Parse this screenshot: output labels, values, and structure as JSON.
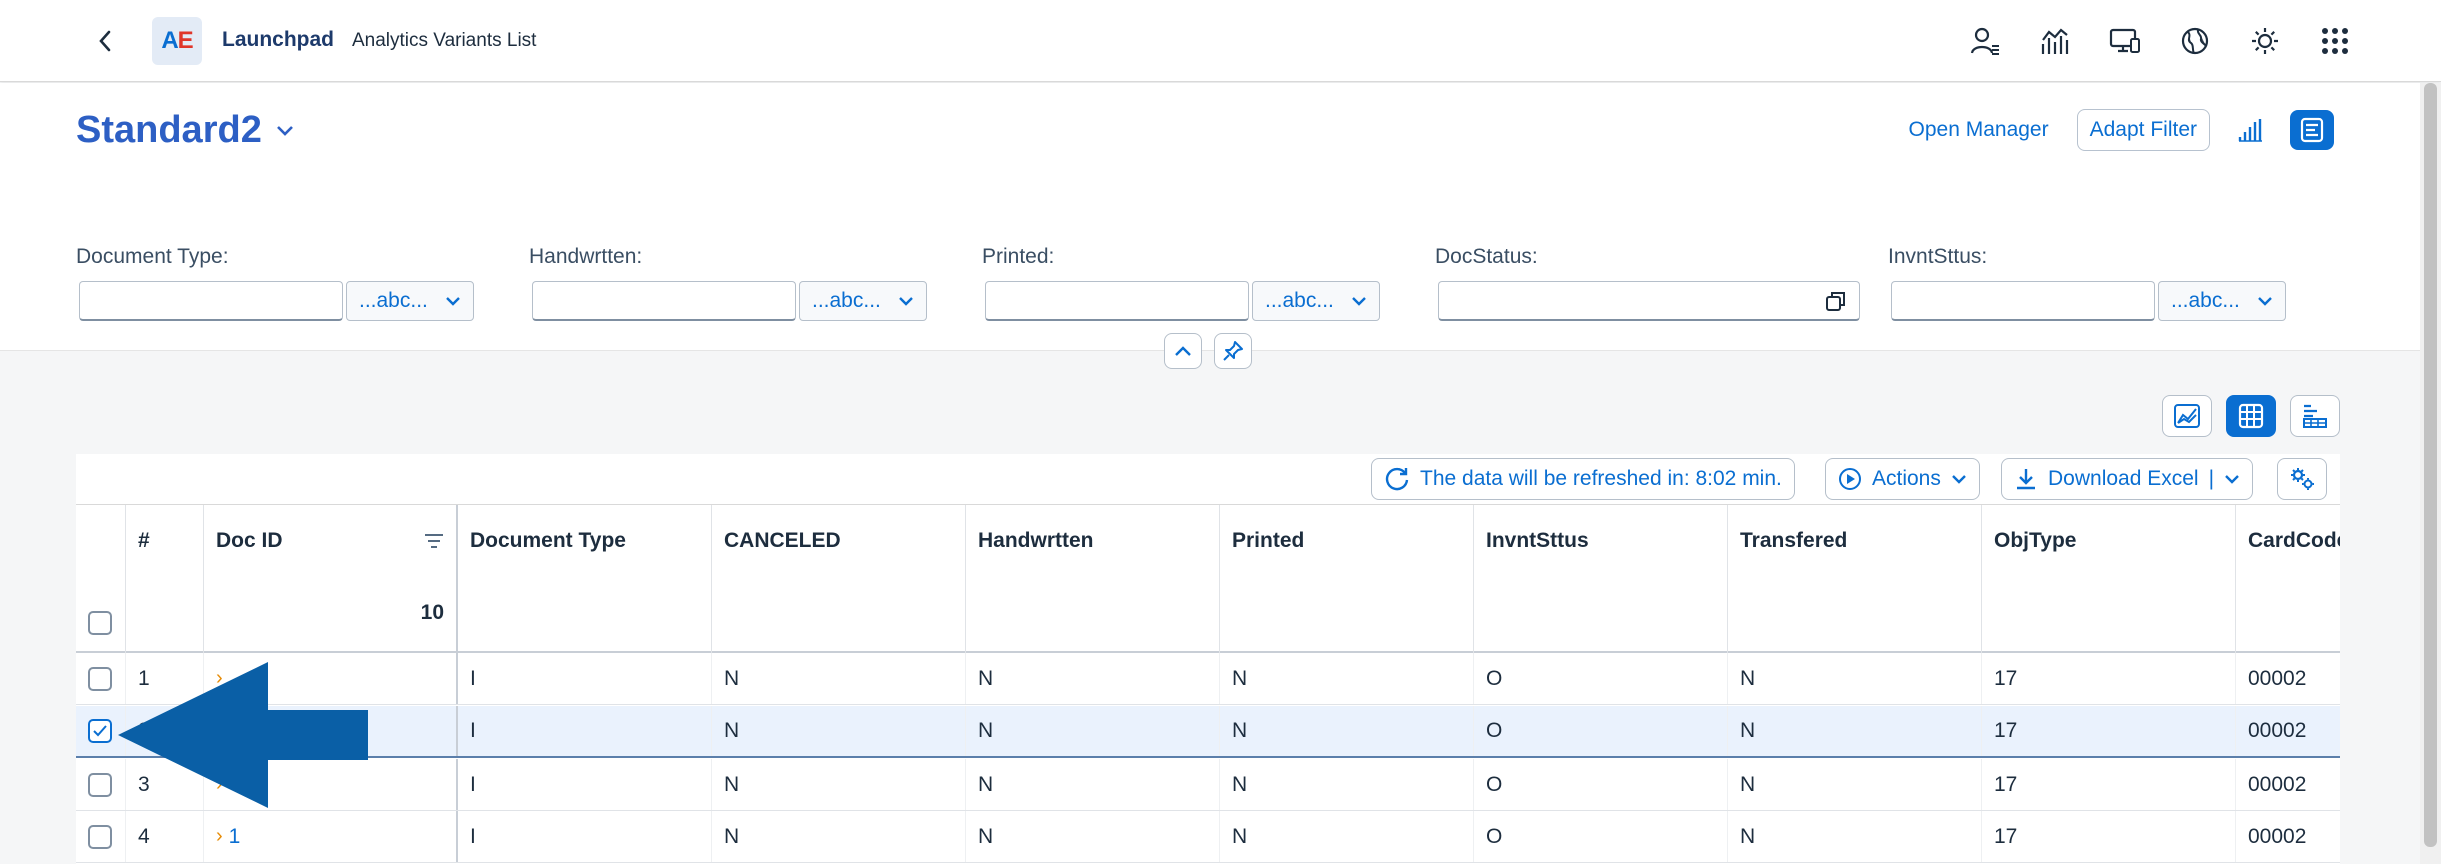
{
  "shell": {
    "logo_text_a": "A",
    "logo_text_e": "E",
    "title": "Launchpad",
    "subtitle": "Analytics Variants List",
    "actions": [
      "user-menu-icon",
      "analytics-icon",
      "device-icon",
      "globe-icon",
      "theme-icon",
      "app-grid-icon"
    ]
  },
  "header": {
    "variant_name": "Standard2",
    "open_manager": "Open Manager",
    "adapt_filter": "Adapt Filter"
  },
  "filters": [
    {
      "label": "Document Type:",
      "value": "",
      "button": "...abc..."
    },
    {
      "label": "Handwrtten:",
      "value": "",
      "button": "...abc..."
    },
    {
      "label": "Printed:",
      "value": "",
      "button": "...abc..."
    },
    {
      "label": "DocStatus:",
      "value": ""
    },
    {
      "label": "InvntSttus:",
      "value": "",
      "button": "...abc..."
    }
  ],
  "toolbar": {
    "refresh_text": "The data will be refreshed in: 8:02 min.",
    "actions": "Actions",
    "download": "Download Excel",
    "download_sep": "|"
  },
  "table": {
    "columns": [
      "#",
      "Doc ID",
      "Document Type",
      "CANCELED",
      "Handwrtten",
      "Printed",
      "InvntSttus",
      "Transfered",
      "ObjType",
      "CardCode"
    ],
    "doc_id_count": "10",
    "rows": [
      {
        "num": "1",
        "doc_id": "",
        "doc_type": "I",
        "canceled": "N",
        "handwritten": "N",
        "printed": "N",
        "invnt": "O",
        "transfered": "N",
        "objtype": "17",
        "cardcode": "00002",
        "selected": false
      },
      {
        "num": "2",
        "doc_id": "",
        "doc_type": "I",
        "canceled": "N",
        "handwritten": "N",
        "printed": "N",
        "invnt": "O",
        "transfered": "N",
        "objtype": "17",
        "cardcode": "00002",
        "selected": true
      },
      {
        "num": "3",
        "doc_id": "",
        "doc_type": "I",
        "canceled": "N",
        "handwritten": "N",
        "printed": "N",
        "invnt": "O",
        "transfered": "N",
        "objtype": "17",
        "cardcode": "00002",
        "selected": false
      },
      {
        "num": "4",
        "doc_id": "1",
        "doc_type": "I",
        "canceled": "N",
        "handwritten": "N",
        "printed": "N",
        "invnt": "O",
        "transfered": "N",
        "objtype": "17",
        "cardcode": "00002",
        "selected": false
      }
    ]
  },
  "colors": {
    "accent": "#0a6ed1",
    "title": "#2d5fc4",
    "annotation_arrow": "#0a5fa6"
  }
}
